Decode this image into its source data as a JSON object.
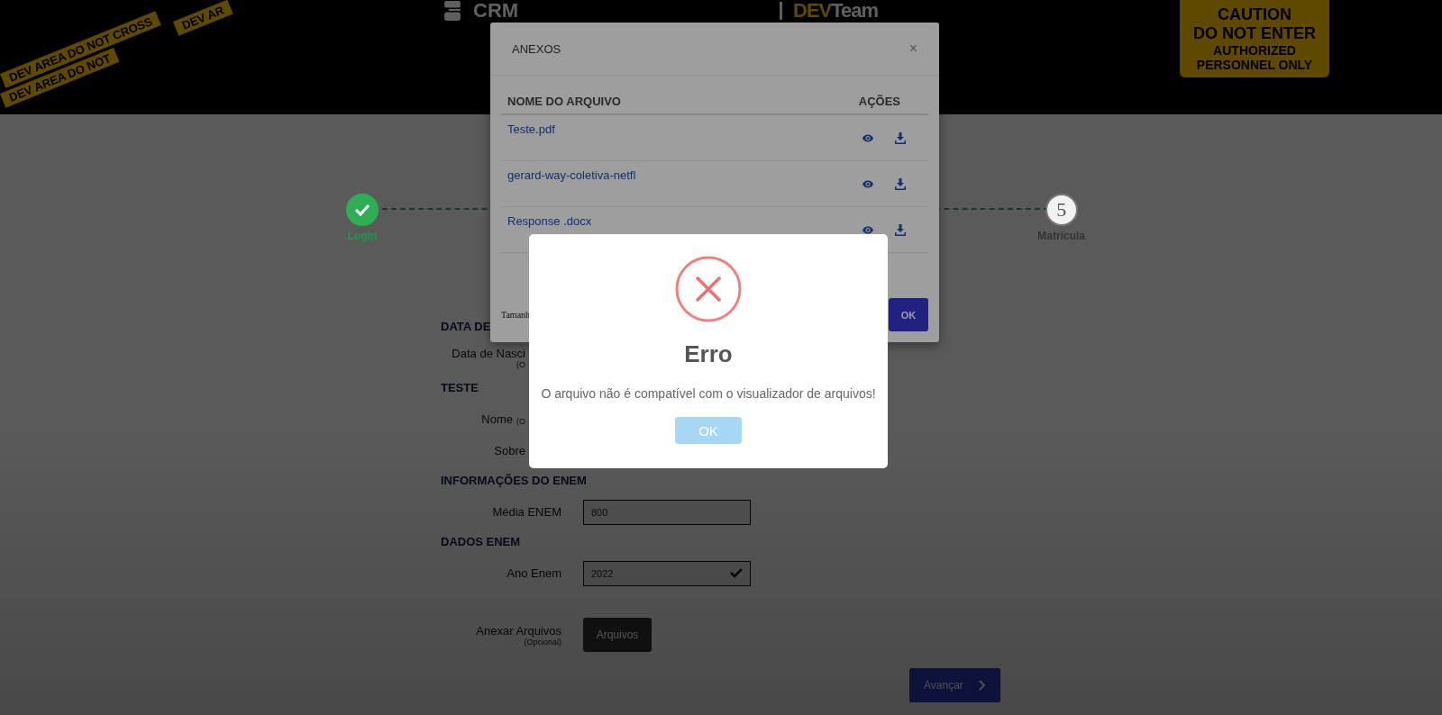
{
  "header": {
    "tapes": [
      "DEV AREA DO NOT CROSS",
      "DEV AREA DO NOT",
      "DEV AR"
    ],
    "logo": {
      "text": "CRM"
    },
    "brand": {
      "highlight": "DEV",
      "rest": "Team"
    },
    "sign": {
      "lines": [
        "CAUTION",
        "DO NOT ENTER",
        "AUTHORIZED",
        "PERSONNEL ONLY"
      ]
    }
  },
  "stepper": {
    "steps": [
      {
        "label": "Login",
        "done": true
      },
      {
        "label": "Matrícula",
        "number": "5",
        "done": false
      }
    ]
  },
  "form": {
    "sections": [
      {
        "title": "DATA DE",
        "fields": [
          {
            "kind": "label",
            "label": "Data de Nasci",
            "hint": "(O"
          }
        ]
      },
      {
        "title": "TESTE",
        "fields": [
          {
            "kind": "inline",
            "label": "Nome",
            "hint": "(O"
          },
          {
            "kind": "label",
            "label": "Sobre"
          }
        ]
      },
      {
        "title": "INFORMAÇÕES DO ENEM",
        "fields": [
          {
            "kind": "input",
            "label": "Média ENEM",
            "value": "800",
            "valid": false
          }
        ]
      },
      {
        "title": "DADOS ENEM",
        "fields": [
          {
            "kind": "input",
            "label": "Ano Enem",
            "value": "2022",
            "valid": true
          }
        ]
      },
      {
        "fields": [
          {
            "kind": "file",
            "label": "Anexar Arquivos",
            "hint": "(Opcional)",
            "button": "Arquivos"
          }
        ]
      }
    ],
    "next_button": "Avançar"
  },
  "anexos_modal": {
    "title": "ANEXOS",
    "close": "×",
    "columns": [
      "NOME DO ARQUIVO",
      "AÇÕES"
    ],
    "files": [
      {
        "name": "Teste.pdf"
      },
      {
        "name": "gerard-way-coletiva-netfl"
      },
      {
        "name": "Response .docx"
      }
    ],
    "footer_text": "Tamanh",
    "ok": "OK"
  },
  "error_dialog": {
    "title": "Erro",
    "message": "O arquivo não é compatível com o visualizador de arquivos!",
    "button": "OK"
  }
}
